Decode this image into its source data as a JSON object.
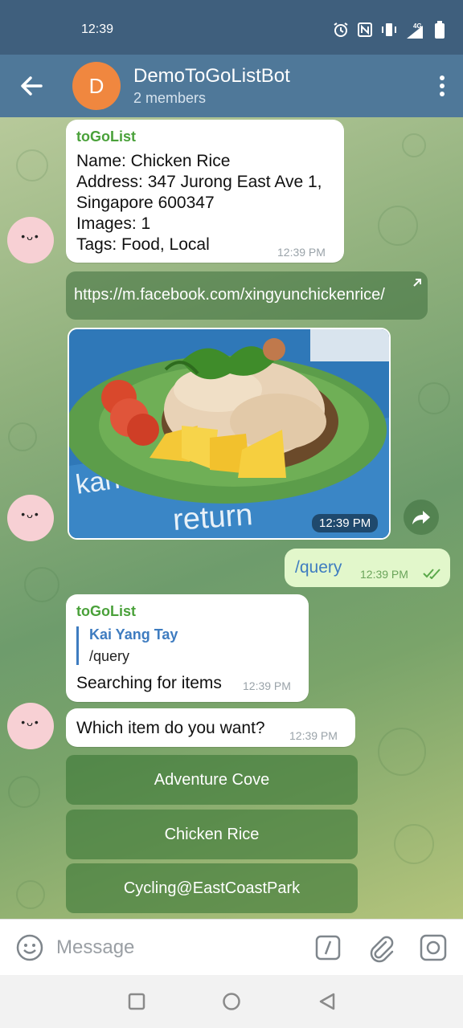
{
  "status_bar": {
    "time": "12:39",
    "icons": [
      "alarm-icon",
      "nfc-icon",
      "vibrate-icon",
      "4g-signal-icon",
      "battery-icon"
    ],
    "network_label": "4G"
  },
  "header": {
    "avatar_letter": "D",
    "title": "DemoToGoListBot",
    "subtitle": "2 members",
    "avatar_color": "#f0873f",
    "bar_color": "#4f7899"
  },
  "messages": {
    "card": {
      "sender": "toGoList",
      "lines": [
        "Name: Chicken Rice",
        "Address: 347 Jurong East Ave 1,",
        "Singapore 600347",
        "Images: 1",
        "Tags: Food, Local"
      ],
      "time": "12:39 PM"
    },
    "link": {
      "url": "https://m.facebook.com/xingyunchickenrice/"
    },
    "photo": {
      "time": "12:39 PM"
    },
    "outgoing": {
      "text": "/query",
      "time": "12:39 PM"
    },
    "reply": {
      "sender": "toGoList",
      "quote_author": "Kai Yang Tay",
      "quote_text": "/query",
      "text": "Searching for items",
      "time": "12:39 PM"
    },
    "question": {
      "text": "Which item do you want?",
      "time": "12:39 PM"
    }
  },
  "keyboard": {
    "buttons": [
      "Adventure Cove",
      "Chicken Rice",
      "Cycling@EastCoastPark"
    ]
  },
  "input": {
    "placeholder": "Message"
  },
  "colors": {
    "sender_green": "#4aa13a",
    "outgoing_bubble": "#e2f7cb",
    "quote_blue": "#3e7cc0"
  }
}
